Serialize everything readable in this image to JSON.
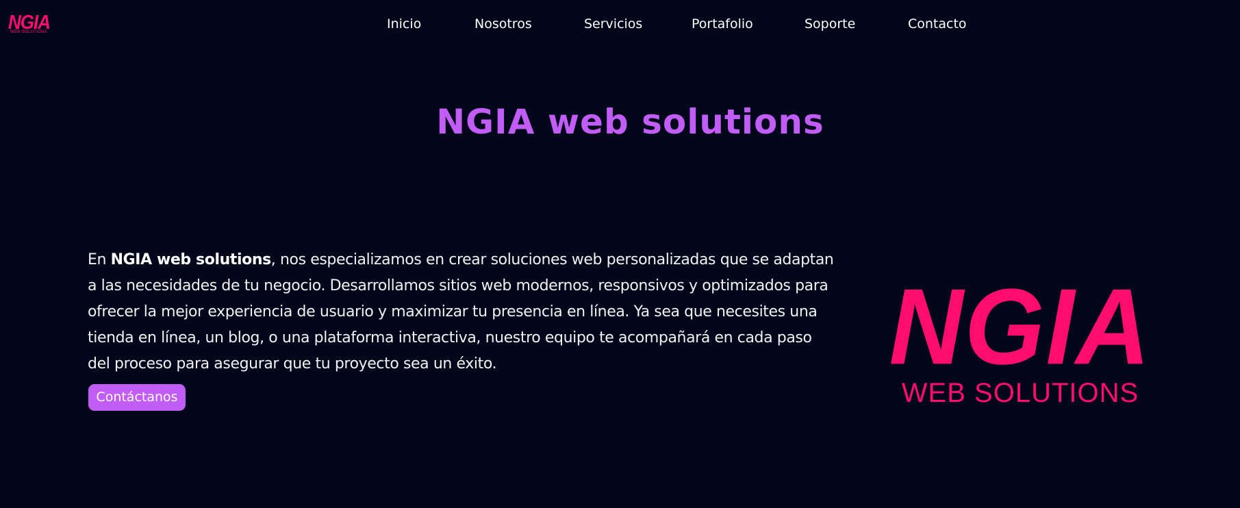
{
  "brand": {
    "logo_text": "NGIA",
    "logo_subtext": "WEB SOLUTIONS",
    "color": "#ff0d6e"
  },
  "nav": {
    "items": [
      {
        "label": "Inicio"
      },
      {
        "label": "Nosotros"
      },
      {
        "label": "Servicios"
      },
      {
        "label": "Portafolio"
      },
      {
        "label": "Soporte"
      },
      {
        "label": "Contacto"
      }
    ]
  },
  "hero": {
    "title": "NGIA web solutions",
    "intro_lead": "En ",
    "intro_brand": "NGIA web solutions",
    "intro_body": ", nos especializamos en crear soluciones web personalizadas que se adaptan a las necesidades de tu negocio. Desarrollamos sitios web modernos, responsivos y optimizados para ofrecer la mejor experiencia de usuario y maximizar tu presencia en línea. Ya sea que necesites una tienda en línea, un blog, o una plataforma interactiva, nuestro equipo te acompañará en cada paso del proceso para asegurar que tu proyecto sea un éxito.",
    "cta_label": "Contáctanos"
  },
  "colors": {
    "background": "#02061a",
    "accent": "#c15cf5",
    "brand": "#ff0d6e"
  }
}
